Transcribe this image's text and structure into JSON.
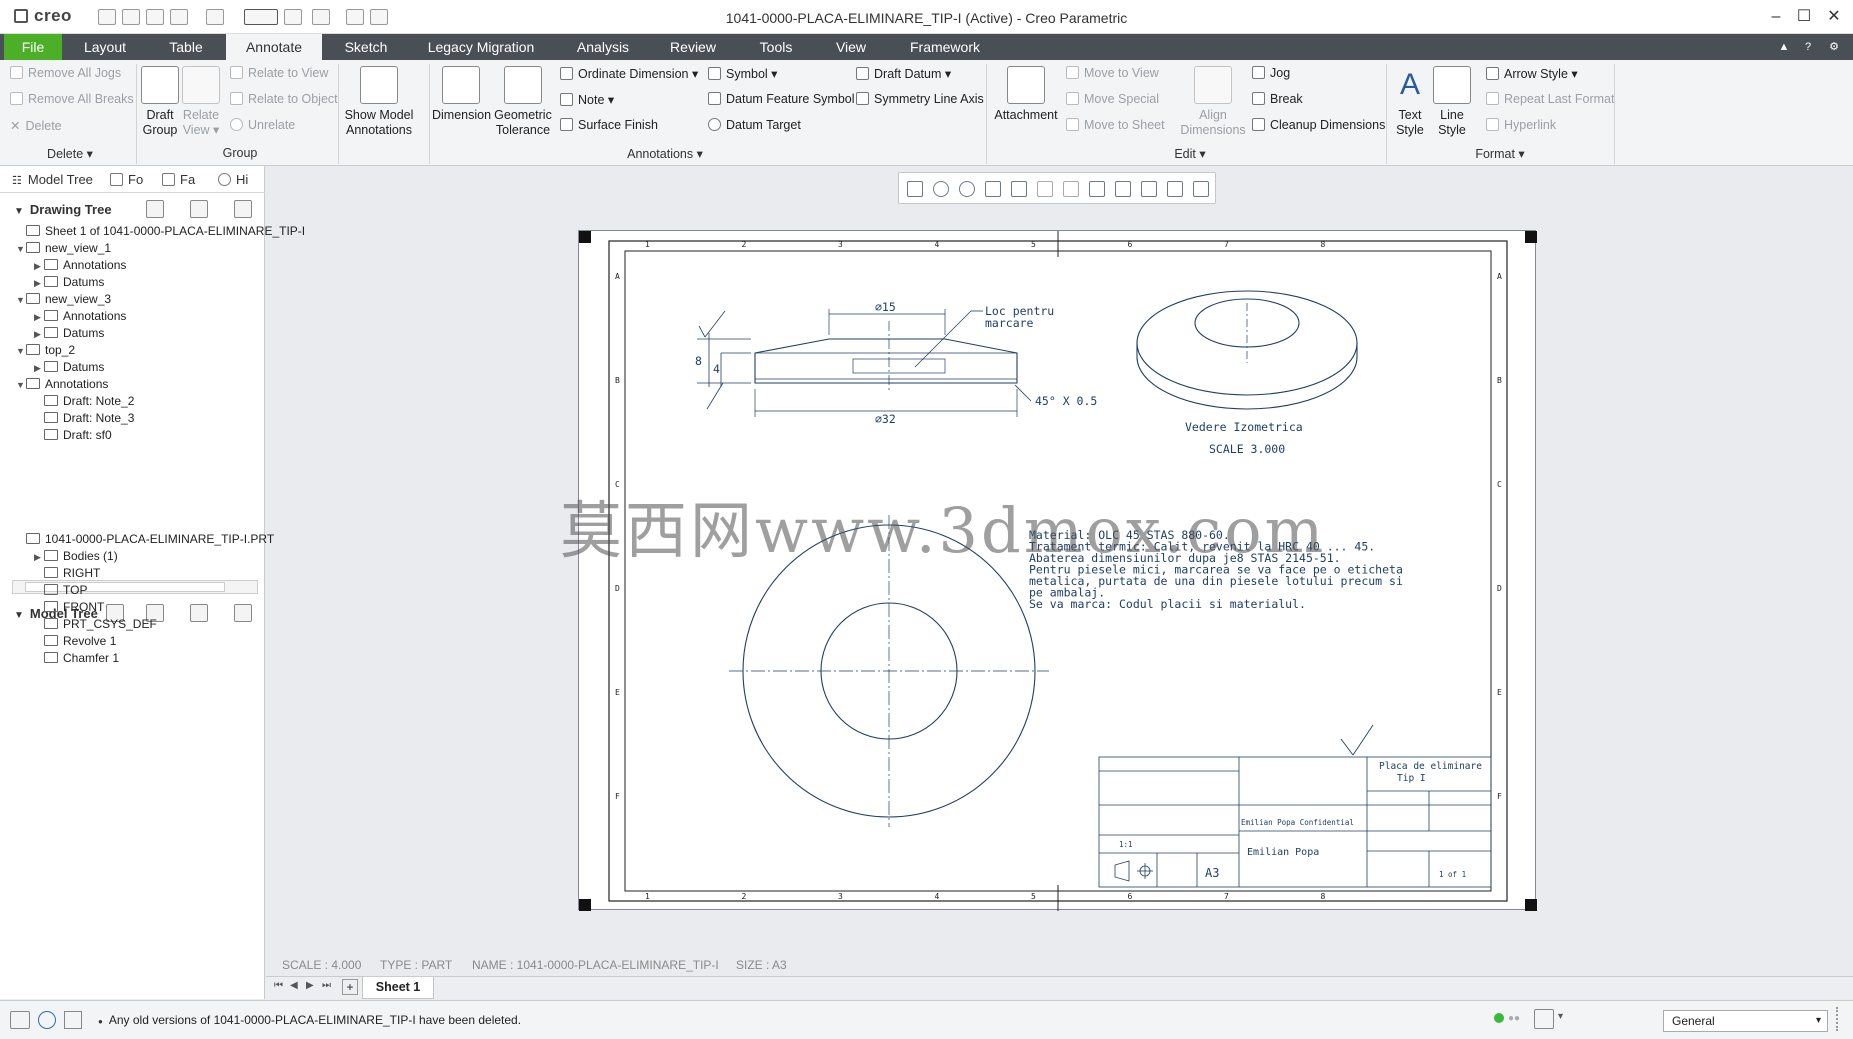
{
  "app": {
    "logo": "creo",
    "window_title": "1041-0000-PLACA-ELIMINARE_TIP-I (Active) - Creo Parametric"
  },
  "tabs": [
    "File",
    "Layout",
    "Table",
    "Annotate",
    "Sketch",
    "Legacy Migration",
    "Analysis",
    "Review",
    "Tools",
    "View",
    "Framework"
  ],
  "active_tab": "Annotate",
  "ribbon": {
    "delete_group": {
      "items": [
        "Remove All Jogs",
        "Remove All Breaks",
        "Delete"
      ],
      "label": "Delete"
    },
    "group_group": {
      "draft_group": "Draft Group",
      "relate_view": "Relate View",
      "items": [
        "Relate to View",
        "Relate to Object",
        "Unrelate"
      ],
      "label": "Group"
    },
    "show_model_annotations": "Show Model Annotations",
    "dimension": "Dimension",
    "geometric_tolerance": "Geometric Tolerance",
    "annotations_col1": [
      "Ordinate Dimension",
      "Note",
      "Surface Finish"
    ],
    "annotations_col2": [
      "Symbol",
      "Datum Feature Symbol",
      "Datum Target"
    ],
    "annotations_col3": [
      "Draft Datum",
      "Symmetry Line Axis"
    ],
    "annotations_label": "Annotations",
    "attachment": "Attachment",
    "edit_items": [
      "Move to View",
      "Move Special",
      "Move to Sheet"
    ],
    "align_dimensions": "Align Dimensions",
    "edit_col2": [
      "Jog",
      "Break",
      "Cleanup Dimensions"
    ],
    "edit_label": "Edit",
    "text_style": "Text Style",
    "line_style": "Line Style",
    "format_items": [
      "Arrow Style",
      "Repeat Last Format",
      "Hyperlink"
    ],
    "format_label": "Format"
  },
  "left_panel": {
    "tabs": [
      "Model Tree",
      "Fo",
      "Fa",
      "Hi"
    ],
    "drawing_tree_title": "Drawing Tree",
    "drawing_tree": [
      {
        "label": "Sheet 1 of 1041-0000-PLACA-ELIMINARE_TIP-I",
        "level": 0,
        "arrow": ""
      },
      {
        "label": "new_view_1",
        "level": 0,
        "arrow": "▼"
      },
      {
        "label": "Annotations",
        "level": 1,
        "arrow": "▶"
      },
      {
        "label": "Datums",
        "level": 1,
        "arrow": "▶"
      },
      {
        "label": "new_view_3",
        "level": 0,
        "arrow": "▼"
      },
      {
        "label": "Annotations",
        "level": 1,
        "arrow": "▶"
      },
      {
        "label": "Datums",
        "level": 1,
        "arrow": "▶"
      },
      {
        "label": "top_2",
        "level": 0,
        "arrow": "▼"
      },
      {
        "label": "Datums",
        "level": 1,
        "arrow": "▶"
      },
      {
        "label": "Annotations",
        "level": -1,
        "arrow": "▼"
      },
      {
        "label": "Draft: Note_2",
        "level": 1,
        "arrow": ""
      },
      {
        "label": "Draft: Note_3",
        "level": 1,
        "arrow": ""
      },
      {
        "label": "Draft: sf0",
        "level": 1,
        "arrow": ""
      }
    ],
    "model_tree_title": "Model Tree",
    "model_tree": [
      {
        "label": "1041-0000-PLACA-ELIMINARE_TIP-I.PRT",
        "level": 0,
        "arrow": ""
      },
      {
        "label": "Bodies (1)",
        "level": 1,
        "arrow": "▶"
      },
      {
        "label": "RIGHT",
        "level": 1,
        "arrow": ""
      },
      {
        "label": "TOP",
        "level": 1,
        "arrow": ""
      },
      {
        "label": "FRONT",
        "level": 1,
        "arrow": ""
      },
      {
        "label": "PRT_CSYS_DEF",
        "level": 1,
        "arrow": ""
      },
      {
        "label": "Revolve 1",
        "level": 1,
        "arrow": ""
      },
      {
        "label": "Chamfer 1",
        "level": 1,
        "arrow": ""
      }
    ]
  },
  "drawing": {
    "dim_d15": "⌀15",
    "dim_d32": "⌀32",
    "dim_8": "8",
    "dim_4": "4",
    "note_loc_1": "Loc pentru",
    "note_loc_2": "marcare",
    "chamfer": "45° X 0.5",
    "iso_label": "Vedere Izometrica",
    "iso_scale": "SCALE 3.000",
    "notes": [
      "Material: OLC 45 STAS 880-60.",
      "Tratament termic: Calit, revenit la HRC 40 ... 45.",
      "Abaterea dimensiunilor dupa je8 STAS 2145-51.",
      "Pentru piesele mici, marcarea se va face pe o eticheta",
      "metalica, purtata de una din piesele lotului precum si",
      "pe ambalaj.",
      "Se va marca: Codul placii si materialul."
    ],
    "title_block": {
      "name_1": "Placa de eliminare",
      "name_2": "Tip I",
      "confidential": "Emilian Popa Confidential",
      "author": "Emilian Popa",
      "size": "A3",
      "scale": "1:1",
      "sheet": "1 of 1"
    },
    "col_labels": [
      "1",
      "2",
      "3",
      "4",
      "5",
      "6",
      "7",
      "8"
    ],
    "row_labels": [
      "A",
      "B",
      "C",
      "D",
      "E",
      "F"
    ]
  },
  "watermark": "莫西网www.3dmox.com",
  "status_info": {
    "scale": "SCALE : 4.000",
    "type": "TYPE : PART",
    "name": "NAME : 1041-0000-PLACA-ELIMINARE_TIP-I",
    "size": "SIZE : A3"
  },
  "sheet_tab": "Sheet 1",
  "message": "Any old versions of 1041-0000-PLACA-ELIMINARE_TIP-I have been deleted.",
  "filter_value": "General",
  "colors": {
    "file_tab": "#4caf28",
    "tabbar": "#4a4f55",
    "drawing_line": "#1f3f66"
  }
}
